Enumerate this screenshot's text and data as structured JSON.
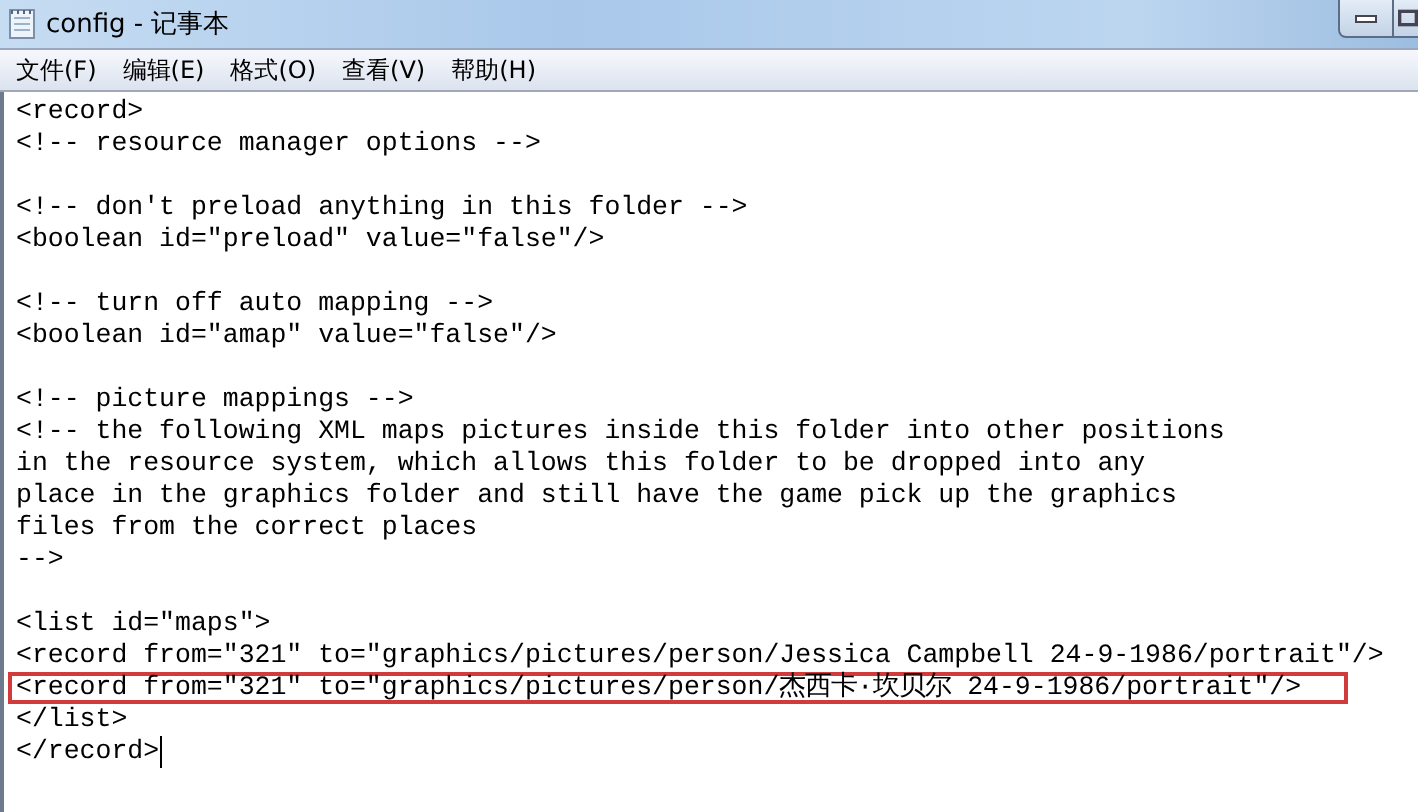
{
  "window": {
    "title": "config - 记事本"
  },
  "menu": [
    {
      "label": "文件(F)"
    },
    {
      "label": "编辑(E)"
    },
    {
      "label": "格式(O)"
    },
    {
      "label": "查看(V)"
    },
    {
      "label": "帮助(H)"
    }
  ],
  "editor": {
    "lines": [
      {
        "kind": "code",
        "text": "<record>",
        "highlighted": false,
        "caret": false
      },
      {
        "kind": "code",
        "text": "<!-- resource manager options -->",
        "highlighted": false,
        "caret": false
      },
      {
        "kind": "blank"
      },
      {
        "kind": "code",
        "text": "<!-- don't preload anything in this folder -->",
        "highlighted": false,
        "caret": false
      },
      {
        "kind": "code",
        "text": "<boolean id=\"preload\" value=\"false\"/>",
        "highlighted": false,
        "caret": false
      },
      {
        "kind": "blank"
      },
      {
        "kind": "code",
        "text": "<!-- turn off auto mapping -->",
        "highlighted": false,
        "caret": false
      },
      {
        "kind": "code",
        "text": "<boolean id=\"amap\" value=\"false\"/>",
        "highlighted": false,
        "caret": false
      },
      {
        "kind": "blank"
      },
      {
        "kind": "code",
        "text": "<!-- picture mappings -->",
        "highlighted": false,
        "caret": false
      },
      {
        "kind": "code",
        "text": "<!-- the following XML maps pictures inside this folder into other positions",
        "highlighted": false,
        "caret": false
      },
      {
        "kind": "code",
        "text": "in the resource system, which allows this folder to be dropped into any",
        "highlighted": false,
        "caret": false
      },
      {
        "kind": "code",
        "text": "place in the graphics folder and still have the game pick up the graphics",
        "highlighted": false,
        "caret": false
      },
      {
        "kind": "code",
        "text": "files from the correct places",
        "highlighted": false,
        "caret": false
      },
      {
        "kind": "code",
        "text": "-->",
        "highlighted": false,
        "caret": false
      },
      {
        "kind": "blank"
      },
      {
        "kind": "code",
        "text": "<list id=\"maps\">",
        "highlighted": false,
        "caret": false
      },
      {
        "kind": "code",
        "text": "<record from=\"321\" to=\"graphics/pictures/person/Jessica Campbell 24-9-1986/portrait\"/>",
        "highlighted": false,
        "caret": false
      },
      {
        "kind": "code",
        "text": "<record from=\"321\" to=\"graphics/pictures/person/杰西卡·坎贝尔 24-9-1986/portrait\"/>",
        "highlighted": true,
        "caret": false
      },
      {
        "kind": "code",
        "text": "</list>",
        "highlighted": false,
        "caret": false
      },
      {
        "kind": "code",
        "text": "</record>",
        "highlighted": false,
        "caret": true
      }
    ]
  }
}
